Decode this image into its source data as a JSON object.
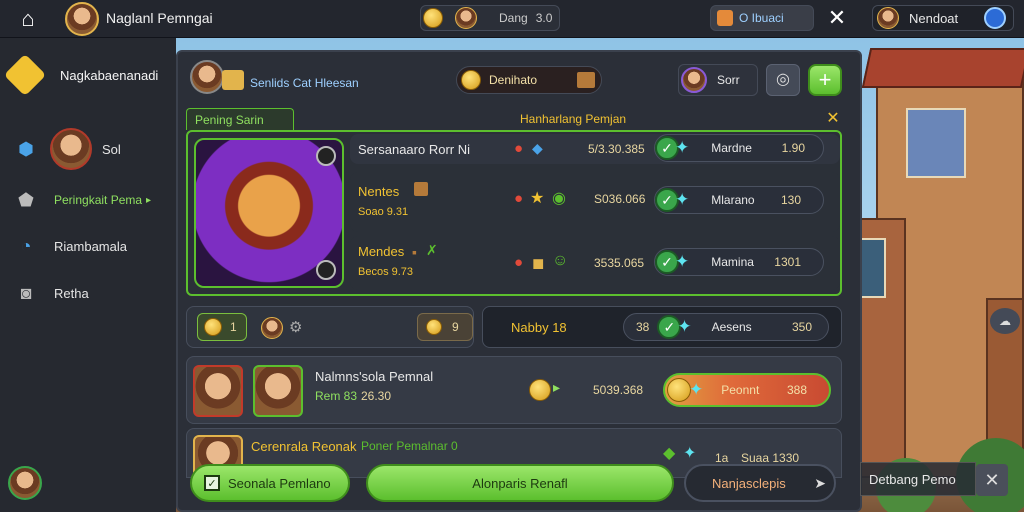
{
  "top_bar": {
    "home_icon": "home-icon",
    "player_name": "Naglanl Pemngai",
    "currency_label": "Dang",
    "currency_value": "3.0",
    "notification_label": "O Ibuaci",
    "close_icon": "close-icon",
    "right_name": "Nendoat",
    "shield_icon": "shield-icon"
  },
  "sidebar": {
    "title": "Nagkabaenanadi",
    "items": [
      {
        "label": "Sol",
        "icon": "shield-icon"
      },
      {
        "label": "Peringkait Pema",
        "icon": "pentagon-icon"
      },
      {
        "label": "Riambamala",
        "icon": "moon-icon"
      },
      {
        "label": "Retha",
        "icon": "camera-icon"
      }
    ]
  },
  "panel": {
    "header_label": "Senlids Cat Hleesan",
    "header_currency": "Denihato",
    "header_right_label": "Sorr",
    "tab_left": "Pening Sarin",
    "tab_center": "Hanharlang Pemjan",
    "close_icon": "close-icon",
    "hero_rows": [
      {
        "name": "Sersanaaro Rorr Ni",
        "value": "5/3.30.385",
        "btn": "Mardne",
        "reward": "1.90"
      },
      {
        "name": "Nentes",
        "sub": "Soao 9.31",
        "value": "S036.066",
        "btn": "Mlarano",
        "reward": "130"
      },
      {
        "name": "Mendes",
        "sub": "Becos 9.73",
        "value": "3535.065",
        "btn": "Mamina",
        "reward": "1301"
      }
    ],
    "mid_bar": {
      "chip1": "1",
      "chip2": "9",
      "center_label": "Nabby 18",
      "left_val": "38",
      "right_label": "Aesens",
      "right_val": "350"
    },
    "list_rows": [
      {
        "title": "Nalmns'sola Pemnal",
        "sub": "Rem 83",
        "sub2": "26.30",
        "value": "5039.368",
        "btn": "Peonnt",
        "btn_val": "388"
      },
      {
        "title": "Cerenrala Reonak",
        "sub": "Poner Pemalnar 0",
        "value": "Suaa 1330",
        "value_prefix": "1a"
      }
    ]
  },
  "bottom": {
    "left_btn": "Seonala Pemlano",
    "center_btn": "Alonparis Renafl",
    "right_btn": "Nanjasclepis",
    "side_label": "Detbang Pemo"
  },
  "colors": {
    "accent_green": "#72d13a",
    "gold": "#e2b44c",
    "bg": "#23262e"
  }
}
